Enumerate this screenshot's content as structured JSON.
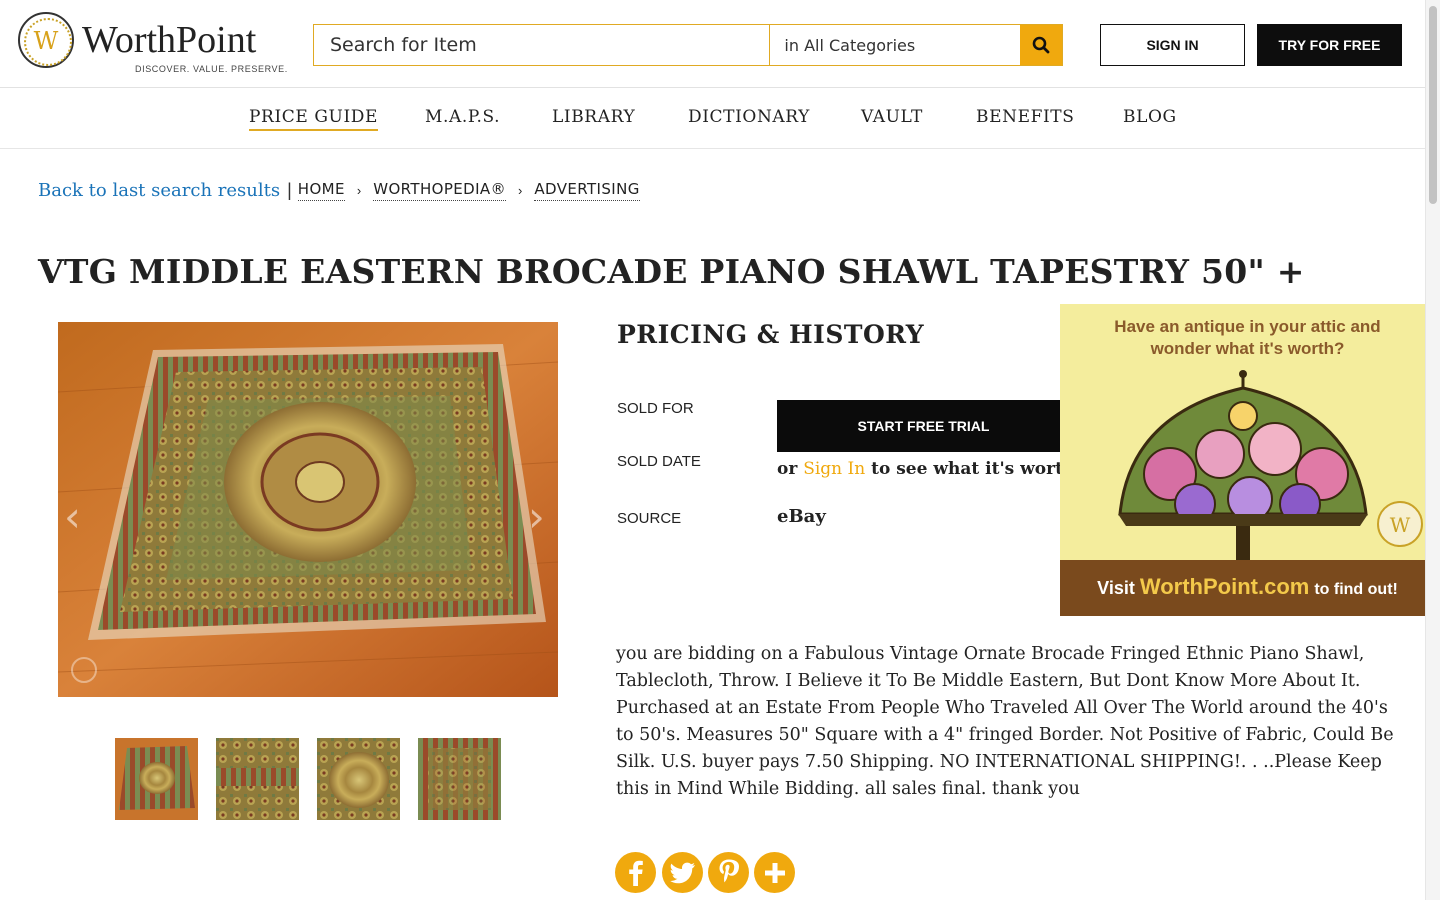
{
  "header": {
    "logo_name": "WorthPoint",
    "logo_tagline": "DISCOVER. VALUE. PRESERVE.",
    "search_placeholder": "Search for Item",
    "search_category": "in All Categories",
    "sign_in_label": "SIGN IN",
    "try_free_label": "TRY FOR FREE",
    "accent_color": "#f0a90e"
  },
  "nav": {
    "items": [
      "PRICE GUIDE",
      "M.A.P.S.",
      "LIBRARY",
      "DICTIONARY",
      "VAULT",
      "BENEFITS",
      "BLOG"
    ],
    "active": "PRICE GUIDE"
  },
  "breadcrumb": {
    "back_label": "Back to last search results",
    "items": [
      "HOME",
      "WORTHOPEDIA®",
      "ADVERTISING"
    ]
  },
  "item": {
    "title": "VTG MIDDLE EASTERN BROCADE PIANO SHAWL TAPESTRY 50\" +",
    "image_count": 4
  },
  "pricing": {
    "heading": "PRICING & HISTORY",
    "sold_for_label": "SOLD FOR",
    "sold_date_label": "SOLD DATE",
    "source_label": "SOURCE",
    "trial_button": "START FREE TRIAL",
    "or_text": "or",
    "sign_in_link": "Sign In",
    "see_worth_text": "to see what it's worth.",
    "source_value": "eBay"
  },
  "ad": {
    "headline_1": "Have an antique in your attic and",
    "headline_2": "wonder what it's worth?",
    "cta_prefix": "Visit",
    "cta_site": "WorthPoint.com",
    "cta_suffix": "to find out!"
  },
  "description": "you are bidding on a Fabulous Vintage Ornate Brocade Fringed Ethnic Piano Shawl, Tablecloth, Throw. I Believe it To Be Middle Eastern, But Dont Know More About It. Purchased at an Estate From People Who Traveled All Over The World around the 40's to 50's. Measures 50\" Square with a 4\" fringed Border. Not Positive of Fabric, Could Be Silk. U.S. buyer pays 7.50 Shipping. NO INTERNATIONAL SHIPPING!. . ..Please Keep this in Mind While Bidding. all sales final. thank you",
  "social": [
    "facebook-icon",
    "twitter-icon",
    "pinterest-icon",
    "plus-icon"
  ]
}
